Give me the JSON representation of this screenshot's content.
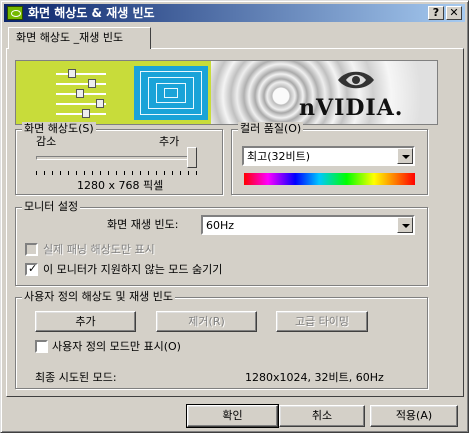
{
  "window": {
    "title": "화면 해상도 & 재생 빈도",
    "help_label": "?",
    "close_label": "✕"
  },
  "tab": {
    "label": "화면 해상도 _재생 빈도"
  },
  "banner": {
    "brand": "nVIDIA."
  },
  "resolution": {
    "group_label": "화면 해상도(S)",
    "min_label": "감소",
    "max_label": "추가",
    "value": "1280 x 768 픽셀",
    "slider_fraction": 1.0
  },
  "color": {
    "group_label": "컬러 품질(O)",
    "selected": "최고(32비트)"
  },
  "monitor": {
    "group_label": "모니터 설정",
    "refresh_label": "화면 재생 빈도:",
    "refresh_value": "60Hz",
    "panning_label": "실제 패닝 해상도만 표시",
    "panning_checked": false,
    "hide_modes_label": "이 모니터가 지원하지 않는 모드 숨기기",
    "hide_modes_checked": true
  },
  "custom": {
    "group_label": "사용자 정의 해상도 및 재생 빈도",
    "add_label": "추가",
    "remove_label": "제거(R)",
    "advanced_label": "고급 타이밍",
    "show_custom_label": "사용자 정의 모드만 표시(O)",
    "last_tried_label": "최종 시도된 모드:",
    "last_tried_value": "1280x1024, 32비트, 60Hz"
  },
  "footer": {
    "ok_label": "확인",
    "cancel_label": "취소",
    "apply_label": "적용(A)"
  },
  "colors": {
    "title_start": "#0a246a",
    "title_end": "#a6caf0",
    "banner_green": "#c8dc3a",
    "monitor_blue": "#1aa3d8"
  },
  "icons": [
    "nvidia-title-icon",
    "help-icon",
    "close-icon",
    "nvidia-eye-logo-icon",
    "dropdown-arrow-icon",
    "checkmark-icon"
  ]
}
